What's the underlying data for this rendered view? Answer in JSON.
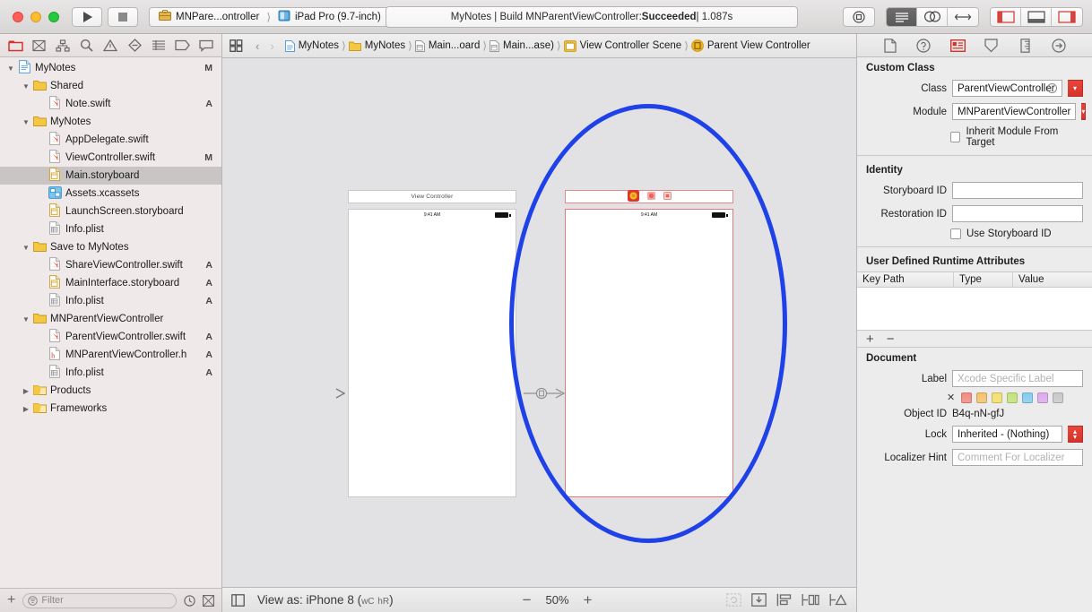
{
  "titlebar": {
    "run_button": "Run",
    "stop_button": "Stop",
    "scheme_name": "MNPare...ontroller",
    "destination": "iPad Pro (9.7-inch)",
    "status_prefix": "MyNotes | Build MNParentViewController: ",
    "status_result": "Succeeded",
    "status_suffix": " | 1.087s",
    "library_button": "Library",
    "editor_standard": "Standard Editor",
    "editor_assistant": "Assistant Editor",
    "editor_version": "Version Editor",
    "view_navigator": "Navigator",
    "view_debug": "Debug Area",
    "view_inspector": "Inspector"
  },
  "navigator": {
    "tabs": [
      {
        "name": "project-navigator",
        "label": "Project"
      },
      {
        "name": "source-control-navigator",
        "label": "Source Control"
      },
      {
        "name": "symbol-navigator",
        "label": "Symbol"
      },
      {
        "name": "find-navigator",
        "label": "Find"
      },
      {
        "name": "issue-navigator",
        "label": "Issue"
      },
      {
        "name": "test-navigator",
        "label": "Test"
      },
      {
        "name": "debug-navigator",
        "label": "Debug"
      },
      {
        "name": "breakpoint-navigator",
        "label": "Breakpoint"
      },
      {
        "name": "report-navigator",
        "label": "Report"
      }
    ],
    "tree": [
      {
        "label": "MyNotes",
        "indent": 0,
        "icon": "project",
        "twisty": "open",
        "status": "M",
        "selected": false
      },
      {
        "label": "Shared",
        "indent": 1,
        "icon": "folder",
        "twisty": "open",
        "status": "",
        "selected": false
      },
      {
        "label": "Note.swift",
        "indent": 2,
        "icon": "swift",
        "twisty": "none",
        "status": "A",
        "selected": false
      },
      {
        "label": "MyNotes",
        "indent": 1,
        "icon": "folder",
        "twisty": "open",
        "status": "",
        "selected": false
      },
      {
        "label": "AppDelegate.swift",
        "indent": 2,
        "icon": "swift",
        "twisty": "none",
        "status": "",
        "selected": false
      },
      {
        "label": "ViewController.swift",
        "indent": 2,
        "icon": "swift",
        "twisty": "none",
        "status": "M",
        "selected": false
      },
      {
        "label": "Main.storyboard",
        "indent": 2,
        "icon": "storyboard",
        "twisty": "none",
        "status": "",
        "selected": true
      },
      {
        "label": "Assets.xcassets",
        "indent": 2,
        "icon": "assets",
        "twisty": "none",
        "status": "",
        "selected": false
      },
      {
        "label": "LaunchScreen.storyboard",
        "indent": 2,
        "icon": "storyboard",
        "twisty": "none",
        "status": "",
        "selected": false
      },
      {
        "label": "Info.plist",
        "indent": 2,
        "icon": "plist",
        "twisty": "none",
        "status": "",
        "selected": false
      },
      {
        "label": "Save to MyNotes",
        "indent": 1,
        "icon": "folder",
        "twisty": "open",
        "status": "",
        "selected": false
      },
      {
        "label": "ShareViewController.swift",
        "indent": 2,
        "icon": "swift",
        "twisty": "none",
        "status": "A",
        "selected": false
      },
      {
        "label": "MainInterface.storyboard",
        "indent": 2,
        "icon": "storyboard",
        "twisty": "none",
        "status": "A",
        "selected": false
      },
      {
        "label": "Info.plist",
        "indent": 2,
        "icon": "plist",
        "twisty": "none",
        "status": "A",
        "selected": false
      },
      {
        "label": "MNParentViewController",
        "indent": 1,
        "icon": "folder",
        "twisty": "open",
        "status": "",
        "selected": false
      },
      {
        "label": "ParentViewController.swift",
        "indent": 2,
        "icon": "swift",
        "twisty": "none",
        "status": "A",
        "selected": false
      },
      {
        "label": "MNParentViewController.h",
        "indent": 2,
        "icon": "header",
        "twisty": "none",
        "status": "A",
        "selected": false
      },
      {
        "label": "Info.plist",
        "indent": 2,
        "icon": "plist",
        "twisty": "none",
        "status": "A",
        "selected": false
      },
      {
        "label": "Products",
        "indent": 1,
        "icon": "folder-closed",
        "twisty": "closed",
        "status": "",
        "selected": false
      },
      {
        "label": "Frameworks",
        "indent": 1,
        "icon": "folder-closed",
        "twisty": "closed",
        "status": "",
        "selected": false
      }
    ],
    "filter_placeholder": "Filter",
    "add_button": "+"
  },
  "jumpbar": {
    "back": "‹",
    "forward": "›",
    "crumbs": [
      {
        "label": "MyNotes",
        "icon": "project"
      },
      {
        "label": "MyNotes",
        "icon": "folder"
      },
      {
        "label": "Main...oard",
        "icon": "storyboard"
      },
      {
        "label": "Main...ase)",
        "icon": "storyboard"
      },
      {
        "label": "View Controller Scene",
        "icon": "scene"
      },
      {
        "label": "Parent View Controller",
        "icon": "viewcontroller"
      }
    ]
  },
  "canvas": {
    "scene_left": {
      "title": "View Controller",
      "status_time": "9:41 AM"
    },
    "scene_right": {
      "title": "",
      "status_time": "9:41 AM",
      "selected": true,
      "dock_icons": [
        "view-controller-icon",
        "first-responder-icon",
        "exit-icon"
      ]
    },
    "annotation": {
      "shape": "ellipse",
      "color": "#1f41e8"
    }
  },
  "canvas_bottom": {
    "view_as_label": "View as: iPhone 8 (",
    "view_as_wc": "wC",
    "view_as_hr": "hR",
    "view_as_close": ")",
    "zoom_out": "−",
    "zoom_level": "50%",
    "zoom_in": "+",
    "tools": [
      {
        "name": "update-frames-button",
        "label": "Update Frames"
      },
      {
        "name": "embed-in-button",
        "label": "Embed In"
      },
      {
        "name": "align-button",
        "label": "Align"
      },
      {
        "name": "add-new-constraints-button",
        "label": "Add New Constraints"
      },
      {
        "name": "resolve-auto-layout-issues-button",
        "label": "Resolve Auto Layout Issues"
      }
    ]
  },
  "inspector": {
    "tabs": [
      {
        "name": "file-inspector",
        "label": "File"
      },
      {
        "name": "quick-help-inspector",
        "label": "Quick Help"
      },
      {
        "name": "identity-inspector",
        "label": "Identity",
        "active": true
      },
      {
        "name": "attributes-inspector",
        "label": "Attributes"
      },
      {
        "name": "size-inspector",
        "label": "Size"
      },
      {
        "name": "connections-inspector",
        "label": "Connections"
      }
    ],
    "custom_class": {
      "section": "Custom Class",
      "class_label": "Class",
      "class_value": "ParentViewController",
      "module_label": "Module",
      "module_value": "MNParentViewController",
      "inherit_label": "Inherit Module From Target",
      "inherit_checked": false
    },
    "identity": {
      "section": "Identity",
      "storyboard_id_label": "Storyboard ID",
      "storyboard_id_value": "",
      "restoration_id_label": "Restoration ID",
      "restoration_id_value": "",
      "use_storyboard_id_label": "Use Storyboard ID",
      "use_storyboard_id_checked": false
    },
    "runtime_attributes": {
      "section": "User Defined Runtime Attributes",
      "columns": [
        "Key Path",
        "Type",
        "Value"
      ],
      "rows": [],
      "add_button": "+",
      "remove_button": "−"
    },
    "document": {
      "section": "Document",
      "label_label": "Label",
      "label_placeholder": "Xcode Specific Label",
      "label_value": "",
      "swatch_none": "✕",
      "swatches": [
        "#f08a80",
        "#f5c26b",
        "#f5e06b",
        "#c3e37a",
        "#82cdf0",
        "#dda9ef",
        "#c9c9c9"
      ],
      "object_id_label": "Object ID",
      "object_id_value": "B4q-nN-gfJ",
      "lock_label": "Lock",
      "lock_value": "Inherited - (Nothing)",
      "localizer_hint_label": "Localizer Hint",
      "localizer_hint_placeholder": "Comment For Localizer"
    }
  }
}
